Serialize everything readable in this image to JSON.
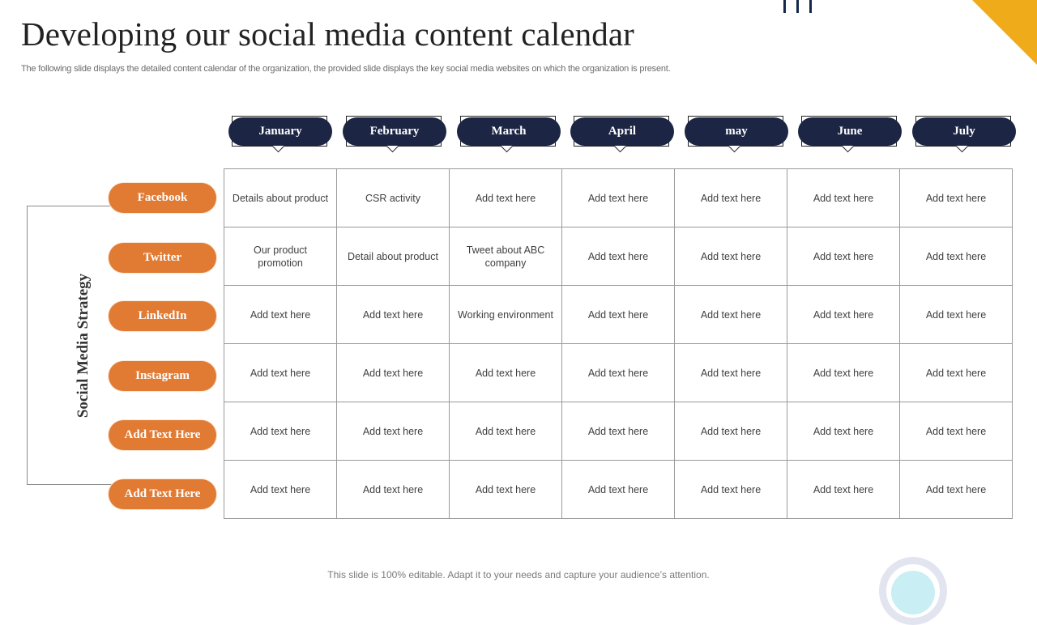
{
  "header": {
    "title": "Developing our social media content calendar",
    "subtitle": "The following slide displays the detailed content calendar of the organization, the provided slide displays the key social media websites on which the organization is present."
  },
  "decor": {
    "corner_color": "#efab1a",
    "bars_icon": "bars-icon",
    "arc_icon": "arc-icon"
  },
  "colors": {
    "month_pill": "#1d2544",
    "platform_pill": "#e17b34"
  },
  "strategy_label": "Social Media Strategy",
  "months": [
    "January",
    "February",
    "March",
    "April",
    "may",
    "June",
    "July"
  ],
  "platforms": [
    "Facebook",
    "Twitter",
    "LinkedIn",
    "Instagram",
    "Add Text Here",
    "Add Text Here"
  ],
  "grid": [
    [
      "Details about product",
      "CSR activity",
      "Add text here",
      "Add text here",
      "Add text here",
      "Add text here",
      "Add text here"
    ],
    [
      "Our product promotion",
      "Detail about product",
      "Tweet  about ABC company",
      "Add text here",
      "Add text here",
      "Add text here",
      "Add text here"
    ],
    [
      "Add text here",
      "Add text here",
      "Working environment",
      "Add text here",
      "Add text here",
      "Add text here",
      "Add text here"
    ],
    [
      "Add text here",
      "Add text here",
      "Add text here",
      "Add text here",
      "Add text here",
      "Add text here",
      "Add text here"
    ],
    [
      "Add text here",
      "Add text here",
      "Add text here",
      "Add text here",
      "Add text here",
      "Add text here",
      "Add text here"
    ],
    [
      "Add text here",
      "Add text here",
      "Add text here",
      "Add text here",
      "Add text here",
      "Add text here",
      "Add text here"
    ]
  ],
  "footer": "This slide is 100% editable. Adapt it to your needs and capture your audience’s attention."
}
